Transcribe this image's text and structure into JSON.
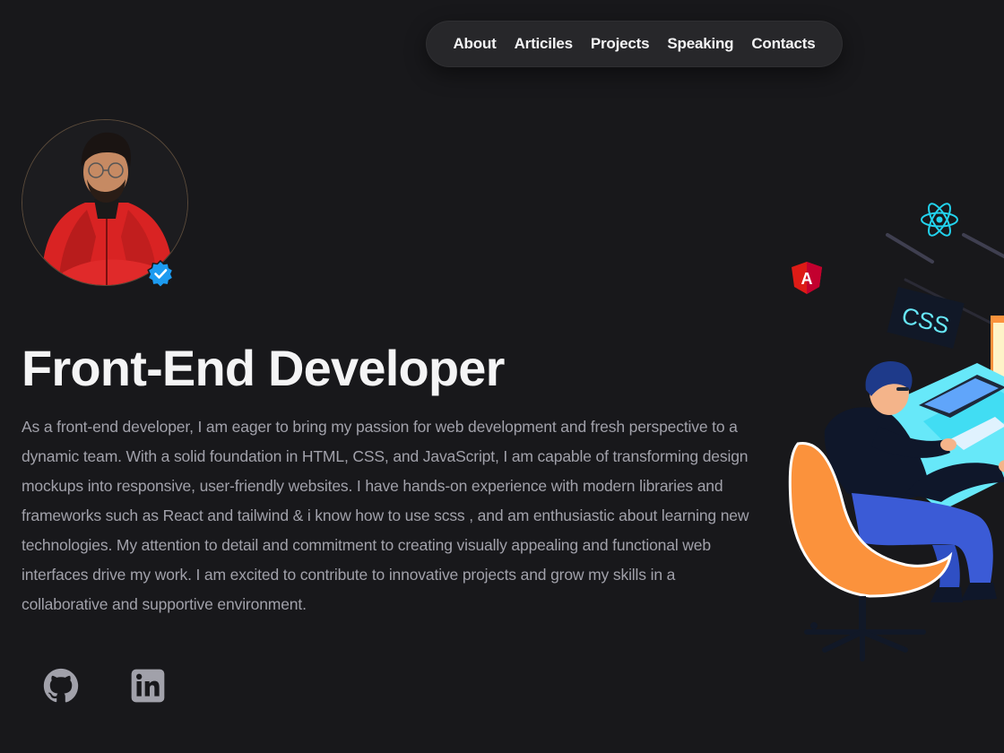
{
  "nav": {
    "items": [
      {
        "label": "About"
      },
      {
        "label": "Articiles"
      },
      {
        "label": "Projects"
      },
      {
        "label": "Speaking"
      },
      {
        "label": "Contacts"
      }
    ]
  },
  "hero": {
    "title": "Front-End Developer",
    "bio": "As a front-end developer, I am eager to bring my passion for web development and fresh perspective to a dynamic team. With a solid foundation in HTML, CSS, and JavaScript, I am capable of transforming design mockups into responsive, user-friendly websites. I have hands-on experience with modern libraries and frameworks such as React and tailwind & i know how to use scss , and am enthusiastic about learning new technologies. My attention to detail and commitment to creating visually appealing and functional web interfaces drive my work. I am excited to contribute to innovative projects and grow my skills in a collaborative and supportive environment."
  },
  "social": {
    "github": {
      "icon": "github-icon"
    },
    "linkedin": {
      "icon": "linkedin-icon"
    }
  },
  "illustration": {
    "css_label": "CSS",
    "angular_label": "A"
  },
  "colors": {
    "background": "#18181b",
    "nav_bg": "#27272a",
    "text_primary": "#f4f4f5",
    "text_muted": "#a1a1aa",
    "verified": "#1d9bf0",
    "chair": "#fb923c"
  }
}
